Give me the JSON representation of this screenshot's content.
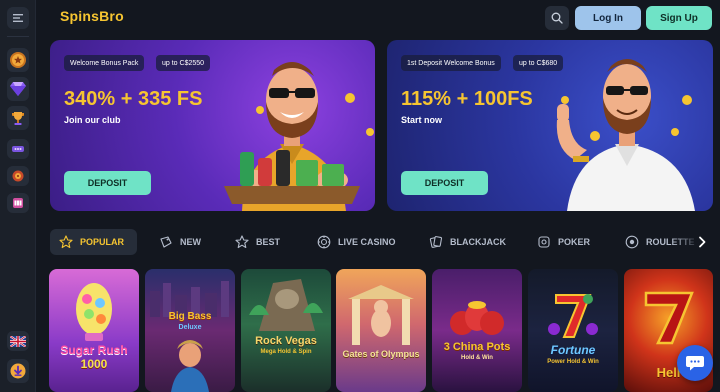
{
  "header": {
    "logo": "SpinsBro",
    "login_label": "Log In",
    "signup_label": "Sign Up"
  },
  "sidebar": {
    "items": [
      {
        "icon": "gold-coin-icon"
      },
      {
        "icon": "diamond-icon"
      },
      {
        "icon": "trophy-icon"
      },
      {
        "icon": "vip-badge-icon"
      },
      {
        "icon": "wheel-icon"
      },
      {
        "icon": "slot-machine-icon"
      }
    ],
    "language_icon": "uk-flag-icon",
    "download_icon": "download-icon"
  },
  "banners": [
    {
      "tag": "Welcome Bonus Pack",
      "amount_tag": "up to C$2550",
      "headline": "340% + 335 FS",
      "subline": "Join our club",
      "button": "DEPOSIT"
    },
    {
      "tag": "1st Deposit Welcome Bonus",
      "amount_tag": "up to C$680",
      "headline": "115% + 100FS",
      "subline": "Start now",
      "button": "DEPOSIT"
    }
  ],
  "categories": [
    {
      "label": "POPULAR",
      "icon": "star-icon",
      "active": true
    },
    {
      "label": "NEW",
      "icon": "tag-icon"
    },
    {
      "label": "BEST",
      "icon": "star-badge-icon"
    },
    {
      "label": "LIVE CASINO",
      "icon": "roulette-chip-icon"
    },
    {
      "label": "BLACKJACK",
      "icon": "cards-icon"
    },
    {
      "label": "POKER",
      "icon": "poker-chip-icon"
    },
    {
      "label": "ROULETTE",
      "icon": "roulette-icon"
    }
  ],
  "games": [
    {
      "title": "Sugar Rush",
      "subtitle": "1000"
    },
    {
      "title": "Big Bass",
      "subtitle": "Deluxe"
    },
    {
      "title": "Rock Vegas",
      "subtitle": "Mega Hold & Spin"
    },
    {
      "title": "Gates of Olympus",
      "subtitle": ""
    },
    {
      "title": "3 China Pots",
      "subtitle": "Hold & Win"
    },
    {
      "title": "Fortune",
      "subtitle": "Power Hold & Win"
    },
    {
      "title": "Hell",
      "subtitle": ""
    }
  ],
  "colors": {
    "accent_yellow": "#f6c531",
    "accent_teal": "#6fe3c6",
    "login_blue": "#9ec4eb",
    "background": "#13171f"
  }
}
